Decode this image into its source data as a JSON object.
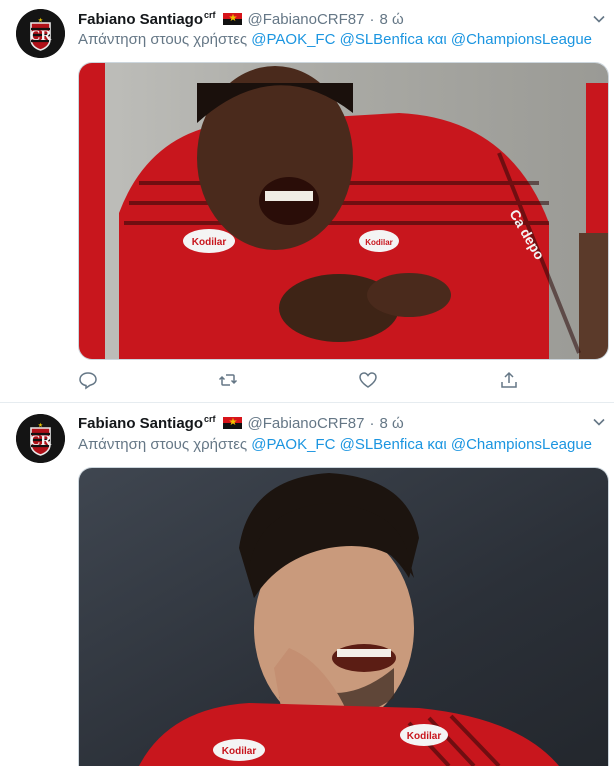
{
  "tweets": [
    {
      "name": "Fabiano Santiago",
      "name_sup": "crf",
      "handle": "@FabianoCRF87",
      "separator": "·",
      "time": "8 ώ",
      "reply_prefix": "Απάντηση στους χρήστες",
      "mention_1": "@PAOK_FC",
      "mention_2": "@SLBenfica",
      "reply_conj": "και",
      "mention_3": "@ChampionsLeague",
      "jersey_text": "Kodilar",
      "jersey_sleeve": "Ca depo"
    },
    {
      "name": "Fabiano Santiago",
      "name_sup": "crf",
      "handle": "@FabianoCRF87",
      "separator": "·",
      "time": "8 ώ",
      "reply_prefix": "Απάντηση στους χρήστες",
      "mention_1": "@PAOK_FC",
      "mention_2": "@SLBenfica",
      "reply_conj": "και",
      "mention_3": "@ChampionsLeague",
      "jersey_text": "Kodilar"
    }
  ],
  "icons": {
    "avatar": "flamengo-crest-icon",
    "flag": "angola-flag-icon",
    "menu": "chevron-down-icon",
    "reply": "reply-icon",
    "retweet": "retweet-icon",
    "like": "heart-icon",
    "share": "share-icon"
  },
  "colors": {
    "link": "#1b95e0",
    "secondary": "#657786",
    "jersey_red": "#c8161d"
  }
}
